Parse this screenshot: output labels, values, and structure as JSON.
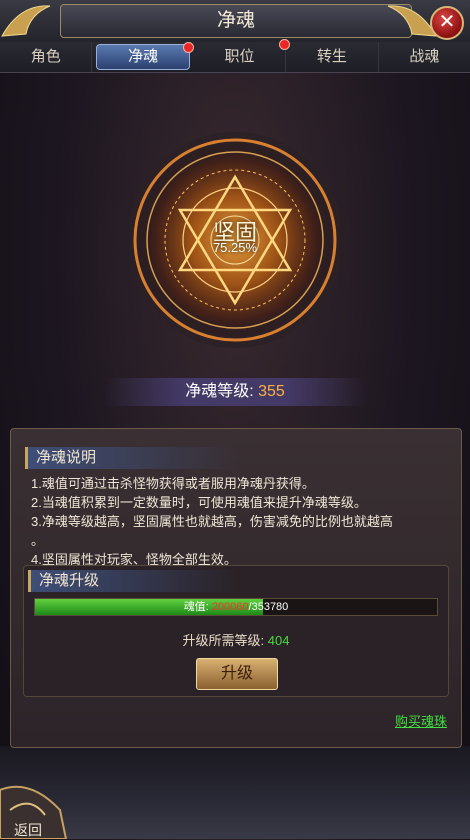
{
  "header": {
    "title": "净魂",
    "close_label": "✕"
  },
  "tabs": [
    {
      "label": "角色",
      "active": false,
      "badge": false
    },
    {
      "label": "净魂",
      "active": true,
      "badge": true
    },
    {
      "label": "职位",
      "active": false,
      "badge": true
    },
    {
      "label": "转生",
      "active": false,
      "badge": false
    },
    {
      "label": "战魂",
      "active": false,
      "badge": false
    }
  ],
  "seal": {
    "name": "坚固",
    "percent": "75.25%"
  },
  "level": {
    "label": "净魂等级:",
    "value": "355"
  },
  "description": {
    "heading": "净魂说明",
    "lines": [
      "1.魂值可通过击杀怪物获得或者服用净魂丹获得。",
      "2.当魂值积累到一定数量时，可使用魂值来提升净魂等级。",
      "3.净魂等级越高，坚固属性也就越高，伤害减免的比例也就越高",
      "。",
      "4.坚固属性对玩家、怪物全部生效。"
    ]
  },
  "upgrade": {
    "heading": "净魂升级",
    "soul_label": "魂值:",
    "soul_current": "200060",
    "soul_max": "/353780",
    "progress_fraction": 0.566,
    "required_label": "升级所需等级:",
    "required_value": "404",
    "button_label": "升级"
  },
  "buy_link": "购买魂珠",
  "back_label": "返回",
  "colors": {
    "accent": "#ffb040",
    "progress": "#40c030",
    "link": "#40e040",
    "current": "#ff3030"
  }
}
